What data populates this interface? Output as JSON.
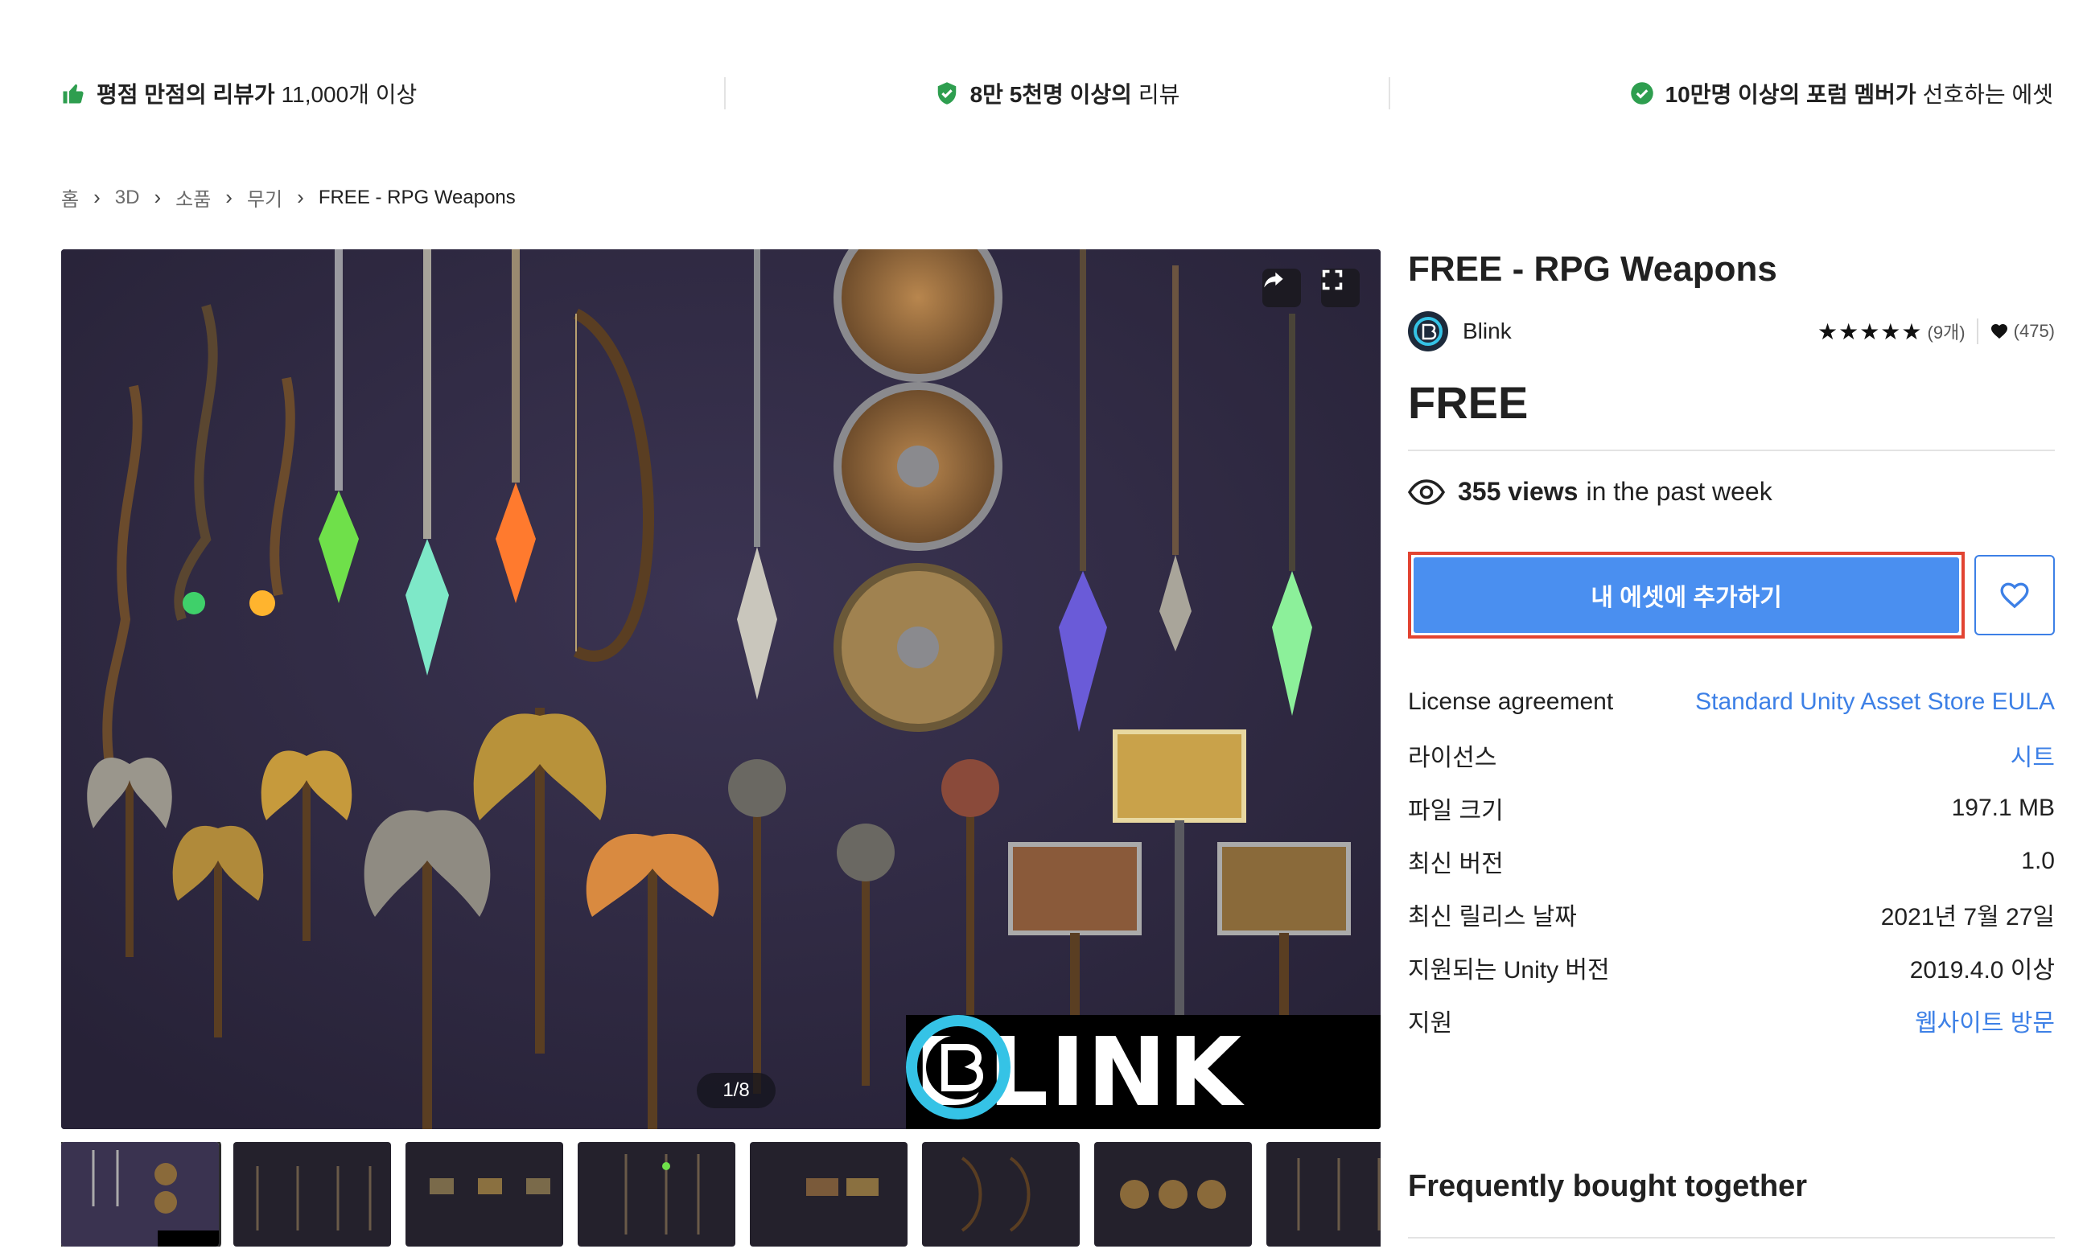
{
  "trust_bar": {
    "item1_bold": "평점 만점의 리뷰가",
    "item1_text": "11,000개 이상",
    "item2_bold": "8만 5천명 이상의",
    "item2_text": "리뷰",
    "item3_bold": "10만명 이상의 포럼 멤버가",
    "item3_text": "선호하는 에셋",
    "colors": {
      "accent": "#2e9e4f"
    }
  },
  "breadcrumb": [
    "홈",
    "3D",
    "소품",
    "무기",
    "FREE - RPG Weapons"
  ],
  "gallery": {
    "counter": "1/8",
    "logo_text": "BLINK",
    "thumbnail_count": 8
  },
  "product": {
    "title": "FREE - RPG Weapons",
    "publisher": "Blink",
    "rating_stars": 5,
    "rating_count": "(9개)",
    "favorites": "(475)",
    "price": "FREE",
    "views_count": "355 views",
    "views_suffix": "in the past week",
    "add_button": "내 에셋에 추가하기",
    "colors": {
      "button": "#4a8ff0",
      "highlight": "#e24432",
      "link": "#3d80e6"
    }
  },
  "specs": [
    {
      "label": "License agreement",
      "value": "Standard Unity Asset Store EULA"
    },
    {
      "label": "라이선스",
      "value": "시트"
    },
    {
      "label": "파일 크기",
      "value": "197.1 MB"
    },
    {
      "label": "최신 버전",
      "value": "1.0"
    },
    {
      "label": "최신 릴리스 날짜",
      "value": "2021년 7월 27일"
    },
    {
      "label": "지원되는 Unity 버전",
      "value": "2019.4.0 이상"
    },
    {
      "label": "지원",
      "value": "웹사이트 방문"
    }
  ],
  "frequently_bought": {
    "heading": "Frequently bought together"
  }
}
